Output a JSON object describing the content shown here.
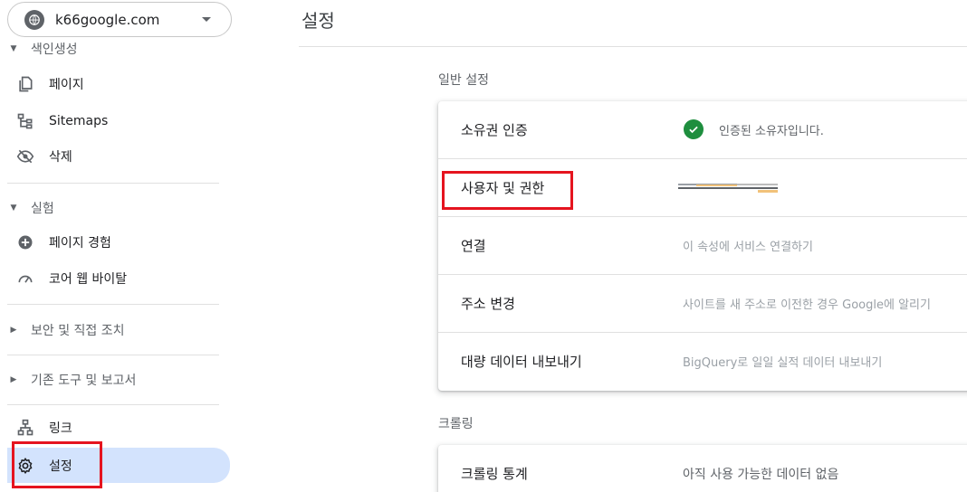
{
  "property_selector": {
    "name": "k66google.com",
    "icon": "globe-icon"
  },
  "sidebar": {
    "partial_header": "색인생성",
    "groups": [
      {
        "items": [
          {
            "label": "페이지",
            "icon": "pages-icon"
          },
          {
            "label": "Sitemaps",
            "icon": "sitemap-icon"
          },
          {
            "label": "삭제",
            "icon": "eye-off-icon"
          }
        ]
      },
      {
        "header": "실험",
        "items": [
          {
            "label": "페이지 경험",
            "icon": "plus-circle-icon"
          },
          {
            "label": "코어 웹 바이탈",
            "icon": "gauge-icon"
          }
        ]
      },
      {
        "header": "보안 및 직접 조치"
      },
      {
        "header": "기존 도구 및 보고서"
      },
      {
        "items": [
          {
            "label": "링크",
            "icon": "links-icon"
          },
          {
            "label": "설정",
            "icon": "gear-icon",
            "active": true
          }
        ]
      }
    ]
  },
  "main": {
    "title": "설정",
    "general": {
      "title": "일반 설정",
      "rows": [
        {
          "label": "소유권 인증",
          "value": "인증된 소유자입니다."
        },
        {
          "label": "사용자 및 권한",
          "value": ""
        },
        {
          "label": "연결",
          "value": "이 속성에 서비스 연결하기"
        },
        {
          "label": "주소 변경",
          "value": "사이트를 새 주소로 이전한 경우 Google에 알리기"
        },
        {
          "label": "대량 데이터 내보내기",
          "value": "BigQuery로 일일 실적 데이터 내보내기"
        }
      ]
    },
    "crawling": {
      "title": "크롤링",
      "rows": [
        {
          "label": "크롤링 통계",
          "value": "아직 사용 가능한 데이터 없음"
        }
      ]
    }
  },
  "colors": {
    "highlight": "#e5141f",
    "active_bg": "#d3e3fd",
    "check": "#1e8e3e"
  }
}
